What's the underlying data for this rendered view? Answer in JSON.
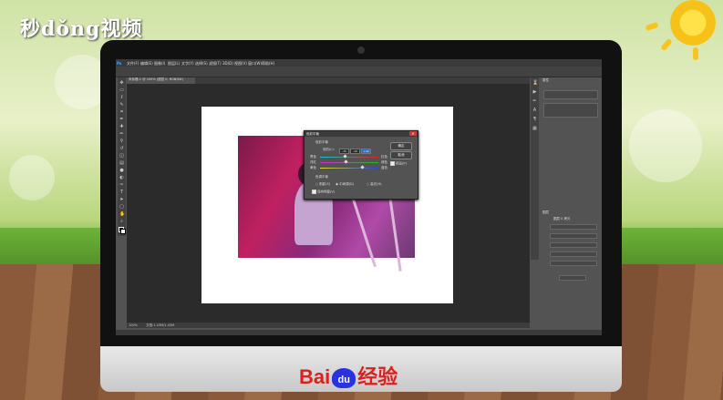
{
  "watermark": {
    "left_logo": "秒dǒng视频",
    "brand": "Bai",
    "brand_paw": "du",
    "brand_suffix": "经验"
  },
  "menu": {
    "items": [
      "文件(F)",
      "编辑(E)",
      "图像(I)",
      "图层(L)",
      "文字(Y)",
      "选择(S)",
      "滤镜(T)",
      "3D(D)",
      "视图(V)",
      "窗口(W)",
      "帮助(H)"
    ]
  },
  "document": {
    "tab_label": "未标题-1 @ 100% (图层 0, RGB/8#)",
    "zoom": "100%",
    "status": "文档:1.43M/1.43M"
  },
  "dialog": {
    "title": "色彩平衡",
    "section_balance": "色彩平衡",
    "levels_label": "色阶(L):",
    "levels": [
      "-15",
      "-10",
      "+44"
    ],
    "cyan": "青色",
    "red": "红色",
    "magenta": "洋红",
    "green": "绿色",
    "yellow": "黄色",
    "blue": "蓝色",
    "section_tone": "色调平衡",
    "shadows": "阴影(S)",
    "midtones": "中间调(D)",
    "highlights": "高光(H)",
    "preserve_luminosity": "保持明度(V)",
    "ok": "确定",
    "cancel": "取消",
    "preview": "预览(P)",
    "slider_values": {
      "cyan_red": -0.15,
      "magenta_green": -0.1,
      "yellow_blue": 0.44
    }
  },
  "panels": {
    "top_tab": "属性",
    "bottom_tab": "图层",
    "bottom_sub": "图层 0 拷贝"
  },
  "colors": {
    "ps_dark": "#535353",
    "ps_panel": "#424242",
    "accent_blue": "#2d6fd0"
  }
}
